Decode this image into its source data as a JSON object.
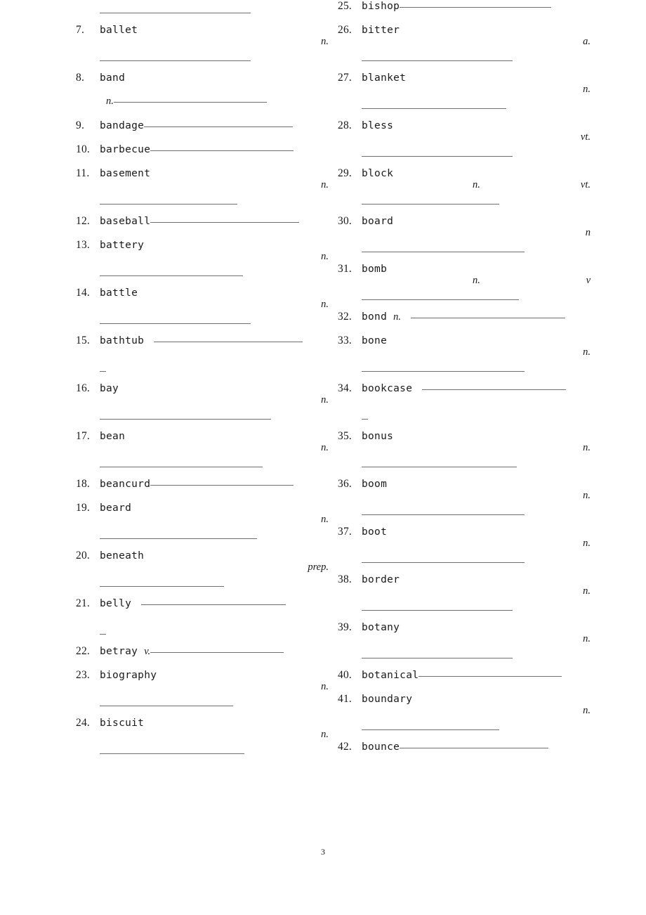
{
  "document": {
    "page_number": "3",
    "rule_color": "#6e6e6e"
  },
  "columns": [
    {
      "id": "left",
      "rows": [
        {
          "kind": "rule",
          "rule_width": 215
        },
        {
          "kind": "entry",
          "number": "7.",
          "word": "ballet",
          "pos_right": "n."
        },
        {
          "kind": "rule",
          "rule_width": 215
        },
        {
          "kind": "entry",
          "number": "8.",
          "word": "band"
        },
        {
          "kind": "entry",
          "number": "",
          "word": "",
          "pos_inline": "n.",
          "rule_attached": 218
        },
        {
          "kind": "entry",
          "number": "9.",
          "word": "bandage",
          "rule_attached": 212
        },
        {
          "kind": "entry",
          "number": "10.",
          "word": "barbecue",
          "rule_attached": 204
        },
        {
          "kind": "entry",
          "number": "11.",
          "word": "basement",
          "pos_right": "n."
        },
        {
          "kind": "rule",
          "rule_width": 196
        },
        {
          "kind": "entry",
          "number": "12.",
          "word": "baseball",
          "rule_attached": 212
        },
        {
          "kind": "entry",
          "number": "13.",
          "word": "battery",
          "pos_right": "n."
        },
        {
          "kind": "rule",
          "rule_width": 204
        },
        {
          "kind": "entry",
          "number": "14.",
          "word": "battle",
          "pos_right": "n."
        },
        {
          "kind": "rule",
          "rule_width": 215
        },
        {
          "kind": "entry",
          "number": "15.",
          "word": "bathtub",
          "rule_spaced": 212
        },
        {
          "kind": "dash"
        },
        {
          "kind": "entry",
          "number": "16.",
          "word": "bay",
          "pos_right": "n."
        },
        {
          "kind": "rule",
          "rule_width": 244
        },
        {
          "kind": "entry",
          "number": "17.",
          "word": "bean",
          "pos_right": "n."
        },
        {
          "kind": "rule",
          "rule_width": 232
        },
        {
          "kind": "entry",
          "number": "18.",
          "word": "beancurd",
          "rule_attached": 204
        },
        {
          "kind": "entry",
          "number": "19.",
          "word": "beard",
          "pos_right": "n."
        },
        {
          "kind": "rule",
          "rule_width": 224
        },
        {
          "kind": "entry",
          "number": "20.",
          "word": "beneath",
          "pos_right": "prep."
        },
        {
          "kind": "rule",
          "rule_width": 177
        },
        {
          "kind": "entry",
          "number": "21.",
          "word": "belly",
          "rule_spaced": 206
        },
        {
          "kind": "dash"
        },
        {
          "kind": "entry",
          "number": "22.",
          "word": "betray",
          "pos_inline": "v.",
          "rule_attached": 190
        },
        {
          "kind": "entry",
          "number": "23.",
          "word": "biography",
          "pos_right": "n."
        },
        {
          "kind": "rule",
          "rule_width": 190
        },
        {
          "kind": "entry",
          "number": "24.",
          "word": "biscuit",
          "pos_right": "n."
        },
        {
          "kind": "rule",
          "rule_width": 206
        }
      ]
    },
    {
      "id": "right",
      "rows": [
        {
          "kind": "entry",
          "number": "25.",
          "word": "bishop",
          "rule_attached": 216
        },
        {
          "kind": "entry",
          "number": "26.",
          "word": "bitter",
          "pos_right": "a."
        },
        {
          "kind": "rule",
          "rule_width": 215
        },
        {
          "kind": "entry",
          "number": "27.",
          "word": "blanket",
          "pos_right": "n."
        },
        {
          "kind": "rule",
          "rule_width": 206
        },
        {
          "kind": "entry",
          "number": "28.",
          "word": "bless",
          "pos_right": "vt."
        },
        {
          "kind": "rule",
          "rule_width": 215
        },
        {
          "kind": "entry",
          "number": "29.",
          "word": "block",
          "pos_mid": "n.",
          "pos_right": "vt."
        },
        {
          "kind": "rule",
          "rule_width": 196
        },
        {
          "kind": "entry",
          "number": "30.",
          "word": "board",
          "pos_right": "n"
        },
        {
          "kind": "rule",
          "rule_width": 232
        },
        {
          "kind": "entry",
          "number": "31.",
          "word": "bomb",
          "pos_mid": "n.",
          "pos_right": "v"
        },
        {
          "kind": "rule",
          "rule_width": 224
        },
        {
          "kind": "entry",
          "number": "32.",
          "word": "bond",
          "pos_inline": "n.",
          "rule_spaced": 220
        },
        {
          "kind": "entry",
          "number": "33.",
          "word": "bone",
          "pos_right": "n."
        },
        {
          "kind": "rule",
          "rule_width": 232
        },
        {
          "kind": "entry",
          "number": "34.",
          "word": "bookcase",
          "rule_spaced": 205
        },
        {
          "kind": "dash"
        },
        {
          "kind": "entry",
          "number": "35.",
          "word": "bonus",
          "pos_right": "n."
        },
        {
          "kind": "rule",
          "rule_width": 221
        },
        {
          "kind": "entry",
          "number": "36.",
          "word": "boom",
          "pos_right": "n."
        },
        {
          "kind": "rule",
          "rule_width": 232
        },
        {
          "kind": "entry",
          "number": "37.",
          "word": "boot",
          "pos_right": "n."
        },
        {
          "kind": "rule",
          "rule_width": 232
        },
        {
          "kind": "entry",
          "number": "38.",
          "word": "border",
          "pos_right": "n."
        },
        {
          "kind": "rule",
          "rule_width": 215
        },
        {
          "kind": "entry",
          "number": "39.",
          "word": "botany",
          "pos_right": "n."
        },
        {
          "kind": "rule",
          "rule_width": 215
        },
        {
          "kind": "entry",
          "number": "40.",
          "word": "botanical",
          "rule_attached": 204
        },
        {
          "kind": "entry",
          "number": "41.",
          "word": "boundary",
          "pos_right": "n."
        },
        {
          "kind": "rule",
          "rule_width": 196
        },
        {
          "kind": "entry",
          "number": "42.",
          "word": "bounce",
          "rule_attached": 212
        }
      ]
    }
  ]
}
